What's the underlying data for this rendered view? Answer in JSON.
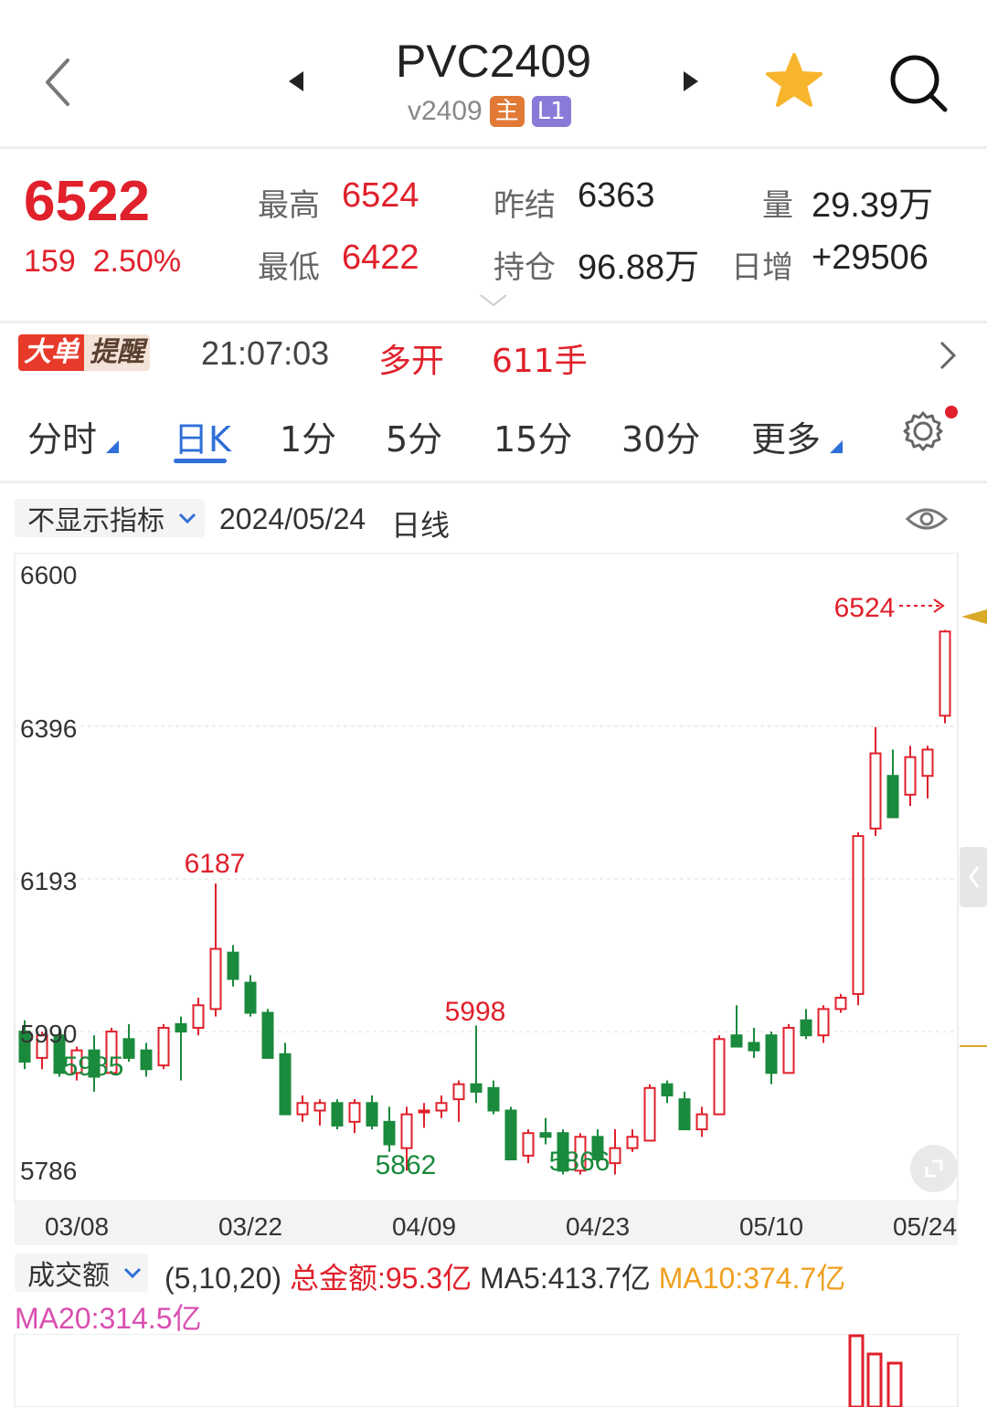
{
  "header": {
    "symbol": "PVC2409",
    "contract_code": "v2409",
    "tag_main": "主",
    "tag_level": "L1"
  },
  "quote": {
    "last_price": "6522",
    "change": "159",
    "change_pct": "2.50%",
    "high_label": "最高",
    "high": "6524",
    "low_label": "最低",
    "low": "6422",
    "prev_settle_label": "昨结",
    "prev_settle": "6363",
    "open_interest_label": "持仓",
    "open_interest": "96.88万",
    "volume_label": "量",
    "volume": "29.39万",
    "daily_change_label": "日增",
    "daily_change": "+29506"
  },
  "alert": {
    "badge_part1": "大单",
    "badge_part2": "提醒",
    "time": "21:07:03",
    "action": "多开",
    "quantity": "611手"
  },
  "tabs": [
    {
      "label": "分时"
    },
    {
      "label": "日K",
      "active": true
    },
    {
      "label": "1分"
    },
    {
      "label": "5分"
    },
    {
      "label": "15分"
    },
    {
      "label": "30分"
    },
    {
      "label": "更多"
    }
  ],
  "chart_header": {
    "indicator_select": "不显示指标",
    "date": "2024/05/24",
    "period": "日线"
  },
  "colors": {
    "up": "#e0202b",
    "down": "#1a8a3c",
    "accent": "#2f6fd8",
    "ma10": "#f0a020",
    "ma20": "#d94fb0",
    "last_price_marker": "#d9a928"
  },
  "chart_data": {
    "type": "candlestick",
    "y_ticks": [
      "6600",
      "6396",
      "6193",
      "5990",
      "5786"
    ],
    "ylim": [
      5786,
      6600
    ],
    "x_ticks": [
      "03/08",
      "03/22",
      "04/09",
      "04/23",
      "05/10",
      "05/24"
    ],
    "annotations": {
      "high_label": "6524",
      "peak_1": "6187",
      "low_start": "5985",
      "low_1": "5862",
      "peak_2": "5998",
      "low_2": "5866"
    },
    "candles": [
      {
        "o": 5990,
        "h": 6005,
        "l": 5940,
        "c": 5950
      },
      {
        "o": 5955,
        "h": 5990,
        "l": 5940,
        "c": 5985
      },
      {
        "o": 5985,
        "h": 5995,
        "l": 5930,
        "c": 5935
      },
      {
        "o": 5935,
        "h": 5970,
        "l": 5925,
        "c": 5965
      },
      {
        "o": 5965,
        "h": 5985,
        "l": 5910,
        "c": 5930
      },
      {
        "o": 5935,
        "h": 5995,
        "l": 5935,
        "c": 5990
      },
      {
        "o": 5980,
        "h": 6000,
        "l": 5950,
        "c": 5955
      },
      {
        "o": 5965,
        "h": 5975,
        "l": 5930,
        "c": 5940
      },
      {
        "o": 5945,
        "h": 6000,
        "l": 5940,
        "c": 5995
      },
      {
        "o": 6000,
        "h": 6010,
        "l": 5925,
        "c": 5990
      },
      {
        "o": 5995,
        "h": 6035,
        "l": 5985,
        "c": 6025
      },
      {
        "o": 6020,
        "h": 6187,
        "l": 6010,
        "c": 6100
      },
      {
        "o": 6095,
        "h": 6105,
        "l": 6050,
        "c": 6060
      },
      {
        "o": 6055,
        "h": 6065,
        "l": 6010,
        "c": 6015
      },
      {
        "o": 6015,
        "h": 6020,
        "l": 5955,
        "c": 5955
      },
      {
        "o": 5960,
        "h": 5975,
        "l": 5880,
        "c": 5880
      },
      {
        "o": 5880,
        "h": 5905,
        "l": 5870,
        "c": 5895
      },
      {
        "o": 5885,
        "h": 5900,
        "l": 5865,
        "c": 5895
      },
      {
        "o": 5895,
        "h": 5900,
        "l": 5860,
        "c": 5865
      },
      {
        "o": 5870,
        "h": 5900,
        "l": 5855,
        "c": 5895
      },
      {
        "o": 5895,
        "h": 5905,
        "l": 5860,
        "c": 5865
      },
      {
        "o": 5870,
        "h": 5890,
        "l": 5830,
        "c": 5840
      },
      {
        "o": 5835,
        "h": 5890,
        "l": 5805,
        "c": 5880
      },
      {
        "o": 5885,
        "h": 5895,
        "l": 5862,
        "c": 5885
      },
      {
        "o": 5885,
        "h": 5905,
        "l": 5875,
        "c": 5895
      },
      {
        "o": 5900,
        "h": 5925,
        "l": 5870,
        "c": 5920
      },
      {
        "o": 5920,
        "h": 5998,
        "l": 5895,
        "c": 5910
      },
      {
        "o": 5915,
        "h": 5925,
        "l": 5880,
        "c": 5885
      },
      {
        "o": 5885,
        "h": 5890,
        "l": 5820,
        "c": 5820
      },
      {
        "o": 5825,
        "h": 5860,
        "l": 5815,
        "c": 5855
      },
      {
        "o": 5855,
        "h": 5875,
        "l": 5840,
        "c": 5850
      },
      {
        "o": 5855,
        "h": 5860,
        "l": 5800,
        "c": 5805
      },
      {
        "o": 5805,
        "h": 5855,
        "l": 5800,
        "c": 5850
      },
      {
        "o": 5850,
        "h": 5860,
        "l": 5815,
        "c": 5820
      },
      {
        "o": 5815,
        "h": 5860,
        "l": 5800,
        "c": 5835
      },
      {
        "o": 5835,
        "h": 5860,
        "l": 5830,
        "c": 5850
      },
      {
        "o": 5845,
        "h": 5920,
        "l": 5845,
        "c": 5915
      },
      {
        "o": 5920,
        "h": 5925,
        "l": 5895,
        "c": 5905
      },
      {
        "o": 5900,
        "h": 5910,
        "l": 5860,
        "c": 5860
      },
      {
        "o": 5860,
        "h": 5890,
        "l": 5850,
        "c": 5880
      },
      {
        "o": 5880,
        "h": 5985,
        "l": 5880,
        "c": 5980
      },
      {
        "o": 5985,
        "h": 6025,
        "l": 5970,
        "c": 5970
      },
      {
        "o": 5975,
        "h": 5995,
        "l": 5955,
        "c": 5965
      },
      {
        "o": 5985,
        "h": 5990,
        "l": 5920,
        "c": 5935
      },
      {
        "o": 5935,
        "h": 6000,
        "l": 5935,
        "c": 5995
      },
      {
        "o": 6005,
        "h": 6020,
        "l": 5980,
        "c": 5985
      },
      {
        "o": 5985,
        "h": 6025,
        "l": 5975,
        "c": 6020
      },
      {
        "o": 6020,
        "h": 6040,
        "l": 6015,
        "c": 6035
      },
      {
        "o": 6040,
        "h": 6255,
        "l": 6025,
        "c": 6250
      },
      {
        "o": 6260,
        "h": 6395,
        "l": 6250,
        "c": 6360
      },
      {
        "o": 6330,
        "h": 6365,
        "l": 6280,
        "c": 6275
      },
      {
        "o": 6305,
        "h": 6370,
        "l": 6290,
        "c": 6355
      },
      {
        "o": 6330,
        "h": 6370,
        "l": 6300,
        "c": 6365
      },
      {
        "o": 6410,
        "h": 6524,
        "l": 6400,
        "c": 6522
      }
    ],
    "indices": [
      {
        "name": "x_start",
        "value": 0
      }
    ]
  },
  "volume": {
    "select": "成交额",
    "params": "(5,10,20)",
    "total": "总金额:95.3亿",
    "ma5": "MA5:413.7亿",
    "ma10": "MA10:374.7亿",
    "ma20": "MA20:314.5亿"
  }
}
